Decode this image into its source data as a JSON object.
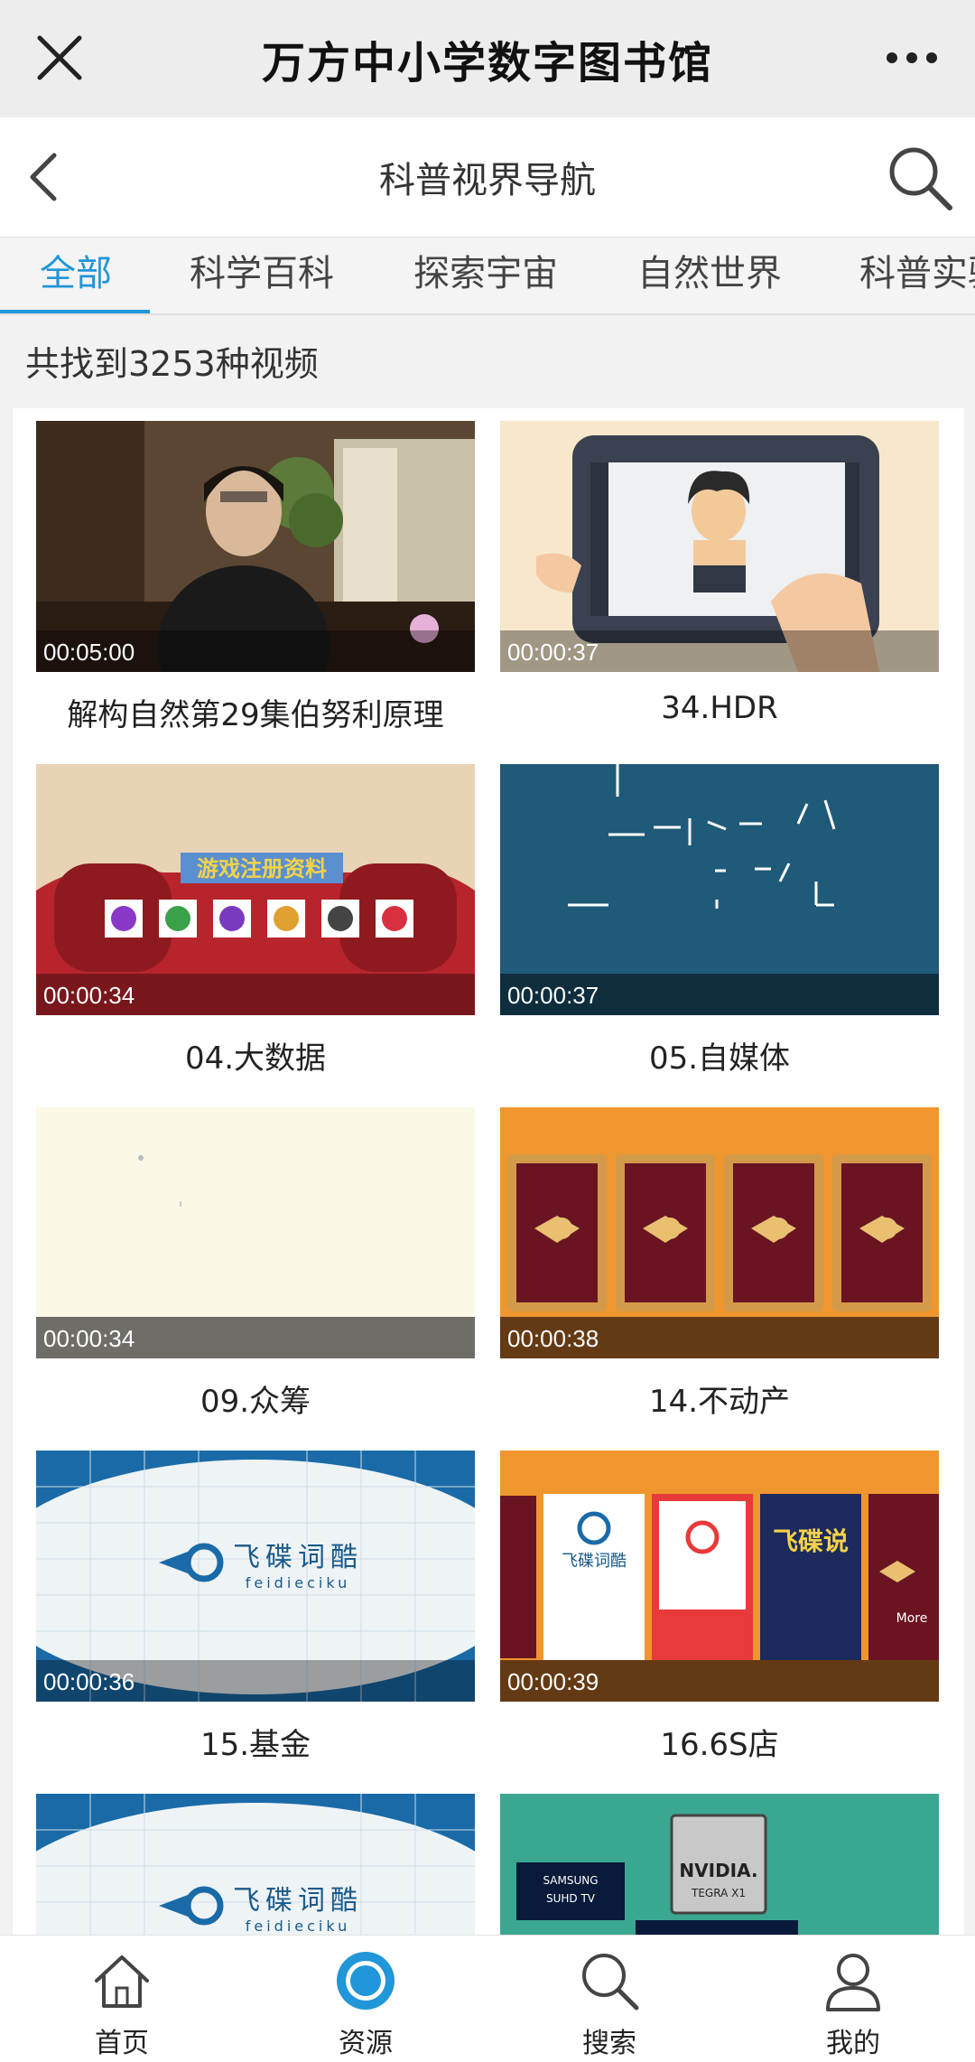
{
  "app_bar": {
    "title": "万方中小学数字图书馆",
    "close_icon": "close-icon",
    "more_icon": "more-dots-icon"
  },
  "header": {
    "title": "科普视界导航",
    "back_icon": "chevron-left-icon",
    "search_icon": "search-icon"
  },
  "tabs": [
    {
      "label": "全部",
      "active": true
    },
    {
      "label": "科学百科"
    },
    {
      "label": "探索宇宙"
    },
    {
      "label": "自然世界"
    },
    {
      "label": "科普实验"
    }
  ],
  "result_count": "共找到3253种视频",
  "videos": [
    {
      "title": "解构自然第29集伯努利原理",
      "duration": "00:05:00"
    },
    {
      "title": "34.HDR",
      "duration": "00:00:37"
    },
    {
      "title": "04.大数据",
      "duration": "00:00:34"
    },
    {
      "title": "05.自媒体",
      "duration": "00:00:37"
    },
    {
      "title": "09.众筹",
      "duration": "00:00:34"
    },
    {
      "title": "14.不动产",
      "duration": "00:00:38"
    },
    {
      "title": "15.基金",
      "duration": "00:00:36"
    },
    {
      "title": "16.6S店",
      "duration": "00:00:39"
    },
    {
      "title": "",
      "duration": ""
    },
    {
      "title": "",
      "duration": ""
    }
  ],
  "thumb_text": {
    "game": "游戏注册资料",
    "brand": "飞碟词酷",
    "brand_sub": "feidieciku",
    "ufo": "飞碟说",
    "more": "More",
    "nvidia": "NVIDIA.",
    "tegra": "TEGRA X1",
    "samsung": "SAMSUNG",
    "suhd": "SUHD TV"
  },
  "bottom_nav": [
    {
      "label": "首页",
      "icon": "home-icon"
    },
    {
      "label": "资源",
      "icon": "resource-circle-icon",
      "active": true
    },
    {
      "label": "搜索",
      "icon": "search-icon"
    },
    {
      "label": "我的",
      "icon": "user-icon"
    }
  ],
  "colors": {
    "accent": "#2196d8",
    "bar_bg": "#ededed"
  }
}
